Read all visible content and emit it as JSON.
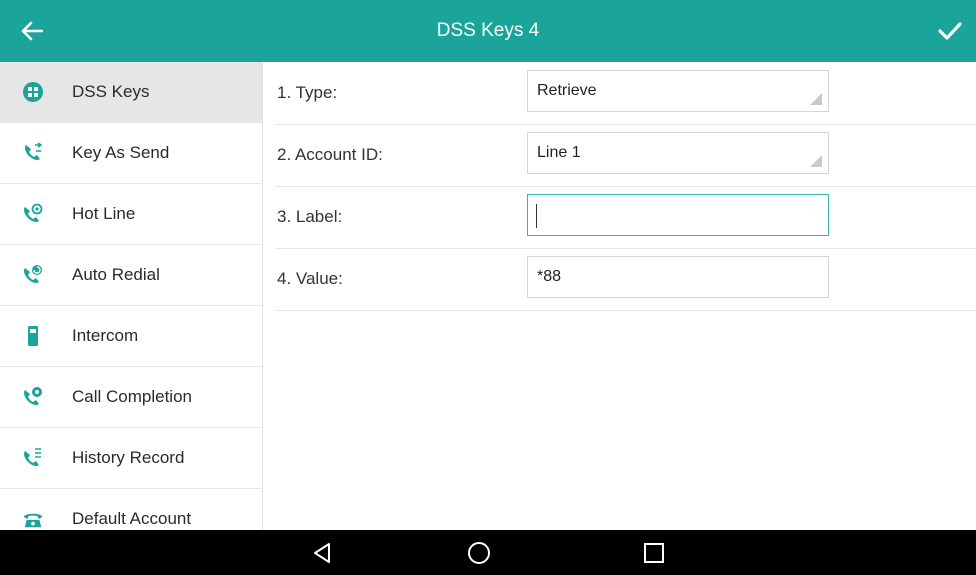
{
  "header": {
    "title": "DSS Keys 4",
    "back_icon": "arrow-left-icon",
    "confirm_icon": "checkmark-icon"
  },
  "colors": {
    "accent": "#1ba59a",
    "active_item_bg": "#e6e6e6",
    "navbar_bg": "#000000"
  },
  "sidebar": {
    "items": [
      {
        "label": "DSS Keys",
        "icon": "dss-keys-icon",
        "active": true
      },
      {
        "label": "Key As Send",
        "icon": "phone-arrows-icon",
        "active": false
      },
      {
        "label": "Hot Line",
        "icon": "phone-hotline-icon",
        "active": false
      },
      {
        "label": "Auto Redial",
        "icon": "phone-redial-icon",
        "active": false
      },
      {
        "label": "Intercom",
        "icon": "intercom-handset-icon",
        "active": false
      },
      {
        "label": "Call Completion",
        "icon": "phone-completion-icon",
        "active": false
      },
      {
        "label": "History Record",
        "icon": "phone-history-icon",
        "active": false
      },
      {
        "label": "Default Account",
        "icon": "desk-phone-icon",
        "active": false
      }
    ]
  },
  "form": {
    "rows": [
      {
        "label": "1. Type:",
        "value": "Retrieve",
        "kind": "select"
      },
      {
        "label": "2. Account ID:",
        "value": "Line 1",
        "kind": "select"
      },
      {
        "label": "3. Label:",
        "value": "",
        "kind": "text-input-focused"
      },
      {
        "label": "4. Value:",
        "value": "*88",
        "kind": "text-input"
      }
    ]
  },
  "navbar": {
    "back_icon": "triangle-back-icon",
    "home_icon": "circle-home-icon",
    "recents_icon": "square-recents-icon"
  }
}
